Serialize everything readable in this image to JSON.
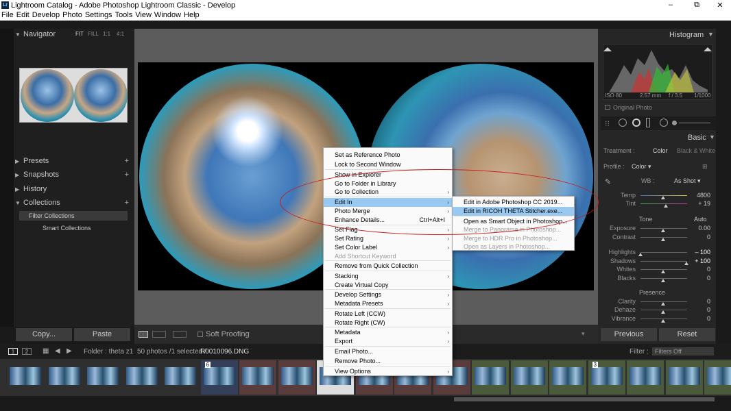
{
  "window": {
    "title": "Lightroom Catalog - Adobe Photoshop Lightroom Classic - Develop",
    "icon": "Lr",
    "min": "–",
    "restore": "⧉",
    "close": "✕"
  },
  "menubar": [
    "File",
    "Edit",
    "Develop",
    "Photo",
    "Settings",
    "Tools",
    "View",
    "Window",
    "Help"
  ],
  "left": {
    "navigator": {
      "title": "Navigator",
      "fit": "FIT",
      "fill": "FILL",
      "one": "1:1",
      "four": "4:1"
    },
    "presets": "Presets",
    "snapshots": "Snapshots",
    "history": "History",
    "collections": "Collections",
    "filter_collections": "Filter Collections",
    "smart_collections": "Smart Collections",
    "copy": "Copy...",
    "paste": "Paste"
  },
  "toolbar": {
    "soft_proofing": "Soft Proofing"
  },
  "right": {
    "histogram": "Histogram",
    "iso": "ISO 80",
    "focal": "2.57 mm",
    "aperture": "f / 3.5",
    "shutter": "1/1000",
    "original_photo": "Original Photo",
    "basic": "Basic",
    "treatment_label": "Treatment :",
    "treatment_color": "Color",
    "treatment_bw": "Black & White",
    "profile_label": "Profile :",
    "profile_value": "Color ▾",
    "wb_label": "WB :",
    "wb_value": "As Shot ▾",
    "temp": "Temp",
    "temp_val": "4800",
    "tint": "Tint",
    "tint_val": "+ 19",
    "tone": "Tone",
    "auto": "Auto",
    "exposure": "Exposure",
    "exposure_val": "0.00",
    "contrast": "Contrast",
    "contrast_val": "0",
    "highlights": "Highlights",
    "highlights_val": "– 100",
    "shadows": "Shadows",
    "shadows_val": "+ 100",
    "whites": "Whites",
    "whites_val": "0",
    "blacks": "Blacks",
    "blacks_val": "0",
    "presence": "Presence",
    "clarity": "Clarity",
    "clarity_val": "0",
    "dehaze": "Dehaze",
    "dehaze_val": "0",
    "vibrance": "Vibrance",
    "vibrance_val": "0",
    "previous": "Previous",
    "reset": "Reset"
  },
  "filmhead": {
    "one": "1",
    "two": "2",
    "folder": "Folder : theta z1",
    "count": "50 photos /1 selected /",
    "file": "R0010096.DNG",
    "filter": "Filter :",
    "filter_value": "Filters Off"
  },
  "film_badges": {
    "b6": "6",
    "b3": "3"
  },
  "context_menu": [
    {
      "label": "Set as Reference Photo"
    },
    {
      "label": "Lock to Second Window"
    },
    {
      "label": "Show in Explorer"
    },
    {
      "label": "Go to Folder in Library"
    },
    {
      "label": "Go to Collection",
      "sub": true
    },
    {
      "label": "Edit In",
      "sub": true,
      "hl": true
    },
    {
      "label": "Photo Merge",
      "sub": true
    },
    {
      "label": "Enhance Details...",
      "shortcut": "Ctrl+Alt+I"
    },
    {
      "label": "Set Flag",
      "sub": true
    },
    {
      "label": "Set Rating",
      "sub": true
    },
    {
      "label": "Set Color Label",
      "sub": true
    },
    {
      "label": "Add Shortcut Keyword",
      "dis": true
    },
    {
      "label": "Remove from Quick Collection"
    },
    {
      "label": "Stacking",
      "sub": true
    },
    {
      "label": "Create Virtual Copy"
    },
    {
      "label": "Develop Settings",
      "sub": true
    },
    {
      "label": "Metadata Presets",
      "sub": true
    },
    {
      "label": "Rotate Left (CCW)"
    },
    {
      "label": "Rotate Right (CW)"
    },
    {
      "label": "Metadata",
      "sub": true
    },
    {
      "label": "Export",
      "sub": true
    },
    {
      "label": "Email Photo..."
    },
    {
      "label": "Remove Photo..."
    },
    {
      "label": "View Options",
      "sub": true
    }
  ],
  "submenu": [
    {
      "label": "Edit in Adobe Photoshop CC 2019..."
    },
    {
      "label": "Edit in RICOH THETA Stitcher.exe...",
      "hl": true
    },
    {
      "label": "Open as Smart Object in Photoshop..."
    },
    {
      "label": "Merge to Panorama in Photoshop...",
      "dis": true
    },
    {
      "label": "Merge to HDR Pro in Photoshop...",
      "dis": true
    },
    {
      "label": "Open as Layers in Photoshop...",
      "dis": true
    }
  ],
  "colors": {
    "highlight": "#99c9f1",
    "annotation": "#c81d1d"
  }
}
